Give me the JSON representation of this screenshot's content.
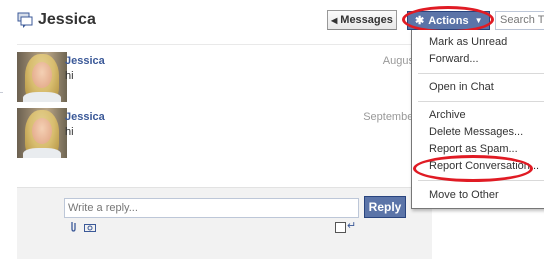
{
  "header": {
    "title": "Jessica",
    "messages_button": "Messages",
    "actions_button": "Actions",
    "search_placeholder": "Search Thi"
  },
  "messages": [
    {
      "sender": "Jessica",
      "body": "hi",
      "date": "August"
    },
    {
      "sender": "Jessica",
      "body": "hi",
      "date": "September"
    }
  ],
  "reply": {
    "placeholder": "Write a reply...",
    "button": "Reply"
  },
  "actions_menu": {
    "items": [
      "Mark as Unread",
      "Forward...",
      "Open in Chat",
      "Archive",
      "Delete Messages...",
      "Report as Spam...",
      "Report Conversation...",
      "Move to Other"
    ]
  },
  "colors": {
    "accent": "#5b74a8",
    "link": "#3b5998",
    "highlight": "#e01b24"
  },
  "icons": [
    "messages-icon",
    "gear-icon",
    "attach-icon",
    "camera-icon"
  ]
}
